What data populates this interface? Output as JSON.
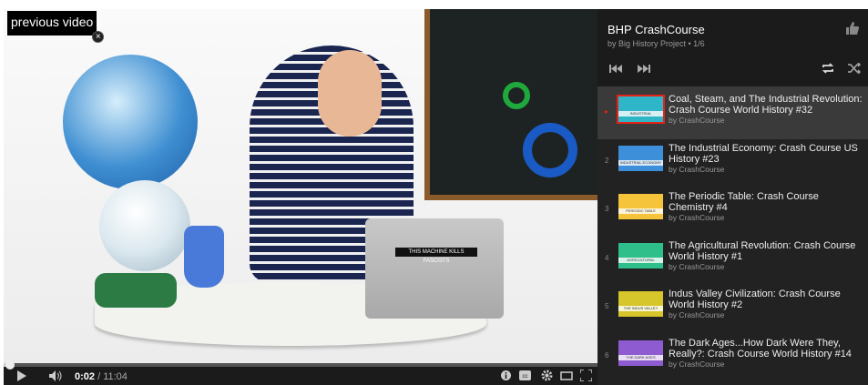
{
  "video": {
    "prev_label": "previous video",
    "close_glyph": "×",
    "laptop_sticker": "THIS MACHINE KILLS FASCISTS",
    "progress_fraction": 0.003
  },
  "controls": {
    "current": "0:02",
    "duration": "/ 11:04",
    "icons": [
      "play-icon",
      "volume-icon",
      "info-icon",
      "captions-icon",
      "settings-icon",
      "theater-icon",
      "fullscreen-icon"
    ]
  },
  "playlist": {
    "title": "BHP CrashCourse",
    "subtitle": "by Big History Project • 1/6",
    "items": [
      {
        "index": "▸",
        "title": "Coal, Steam, and The Industrial Revolution: Crash Course World History #32",
        "by": "by CrashCourse",
        "thumb_color": "#2fb5c8",
        "thumb_text": "INDUSTRIAL REVOLUTION",
        "active": true
      },
      {
        "index": "2",
        "title": "The Industrial Economy: Crash Course US History #23",
        "by": "by CrashCourse",
        "thumb_color": "#3c8fd8",
        "thumb_text": "INDUSTRIAL ECONOMY"
      },
      {
        "index": "3",
        "title": "The Periodic Table: Crash Course Chemistry #4",
        "by": "by CrashCourse",
        "thumb_color": "#f5c43b",
        "thumb_text": "PERIODIC TABLE"
      },
      {
        "index": "4",
        "title": "The Agricultural Revolution: Crash Course World History #1",
        "by": "by CrashCourse",
        "thumb_color": "#2fbf8a",
        "thumb_text": "AGRICULTURAL REVOLUTION"
      },
      {
        "index": "5",
        "title": "Indus Valley Civilization: Crash Course World History #2",
        "by": "by CrashCourse",
        "thumb_color": "#d7c52c",
        "thumb_text": "THE INDUS VALLEY CIVILIZATION"
      },
      {
        "index": "6",
        "title": "The Dark Ages...How Dark Were They, Really?: Crash Course World History #14",
        "by": "by CrashCourse",
        "thumb_color": "#8f5bd1",
        "thumb_text": "THE DARK AGES"
      }
    ]
  }
}
